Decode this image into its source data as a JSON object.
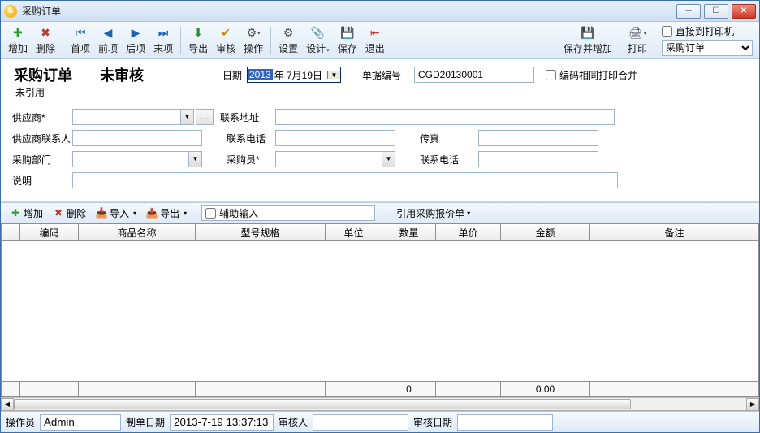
{
  "window": {
    "title": "采购订单"
  },
  "toolbar": {
    "add": "增加",
    "delete": "删除",
    "first": "首项",
    "prev": "前项",
    "next": "后项",
    "last": "末项",
    "export": "导出",
    "audit": "审核",
    "action": "操作",
    "settings": "设置",
    "design": "设计",
    "save": "保存",
    "exit": "退出",
    "save_and_add": "保存并增加",
    "print": "打印",
    "direct_printer": "直接到打印机",
    "template": "采购订单"
  },
  "header": {
    "title": "采购订单",
    "state": "未审核",
    "unref": "未引用",
    "date_label": "日期",
    "date_sel": "2013",
    "date_rest": "年 7月19日",
    "doc_label": "单据编号",
    "doc_no": "CGD20130001",
    "merge_label": "编码相同打印合并"
  },
  "form": {
    "supplier": "供应商*",
    "contact_addr": "联系地址",
    "supplier_contact": "供应商联系人",
    "phone": "联系电话",
    "fax": "传真",
    "dept": "采购部门",
    "buyer": "采购员*",
    "phone2": "联系电话",
    "desc": "说明"
  },
  "gridbar": {
    "add": "增加",
    "delete": "删除",
    "import": "导入",
    "export": "导出",
    "aux": "辅助输入",
    "quote": "引用采购报价单"
  },
  "grid": {
    "cols": [
      "",
      "编码",
      "商品名称",
      "型号规格",
      "单位",
      "数量",
      "单价",
      "金额",
      "备注"
    ],
    "sum_qty": "0",
    "sum_amt": "0.00"
  },
  "status": {
    "operator_label": "操作员",
    "operator": "Admin",
    "make_date_label": "制单日期",
    "make_date": "2013-7-19 13:37:13",
    "auditor_label": "审核人",
    "auditor": "",
    "audit_date_label": "审核日期",
    "audit_date": ""
  }
}
